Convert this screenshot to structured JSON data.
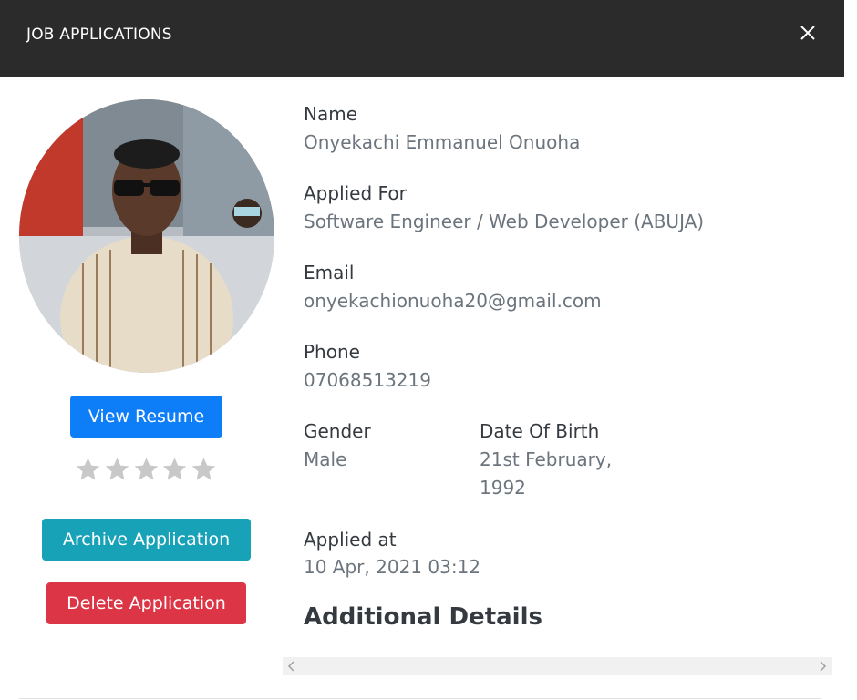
{
  "header": {
    "title": "JOB APPLICATIONS",
    "close_icon": "close-icon"
  },
  "applicant": {
    "actions": {
      "view_resume": "View Resume",
      "archive": "Archive Application",
      "delete": "Delete Application"
    },
    "rating": {
      "value": 0,
      "max": 5
    },
    "fields": {
      "name_label": "Name",
      "name_value": "Onyekachi Emmanuel Onuoha",
      "applied_for_label": "Applied For",
      "applied_for_value": "Software Engineer / Web Developer (ABUJA)",
      "email_label": "Email",
      "email_value": "onyekachionuoha20@gmail.com",
      "phone_label": "Phone",
      "phone_value": "07068513219",
      "gender_label": "Gender",
      "gender_value": "Male",
      "dob_label": "Date Of Birth",
      "dob_value": "21st February, 1992",
      "applied_at_label": "Applied at",
      "applied_at_value": "10 Apr, 2021 03:12"
    },
    "additional_details_title": "Additional Details"
  },
  "colors": {
    "header_bg": "#2b2b2b",
    "primary": "#0d7df8",
    "info": "#17a2b8",
    "danger": "#dc3545",
    "star_empty": "#c8c8c8"
  }
}
